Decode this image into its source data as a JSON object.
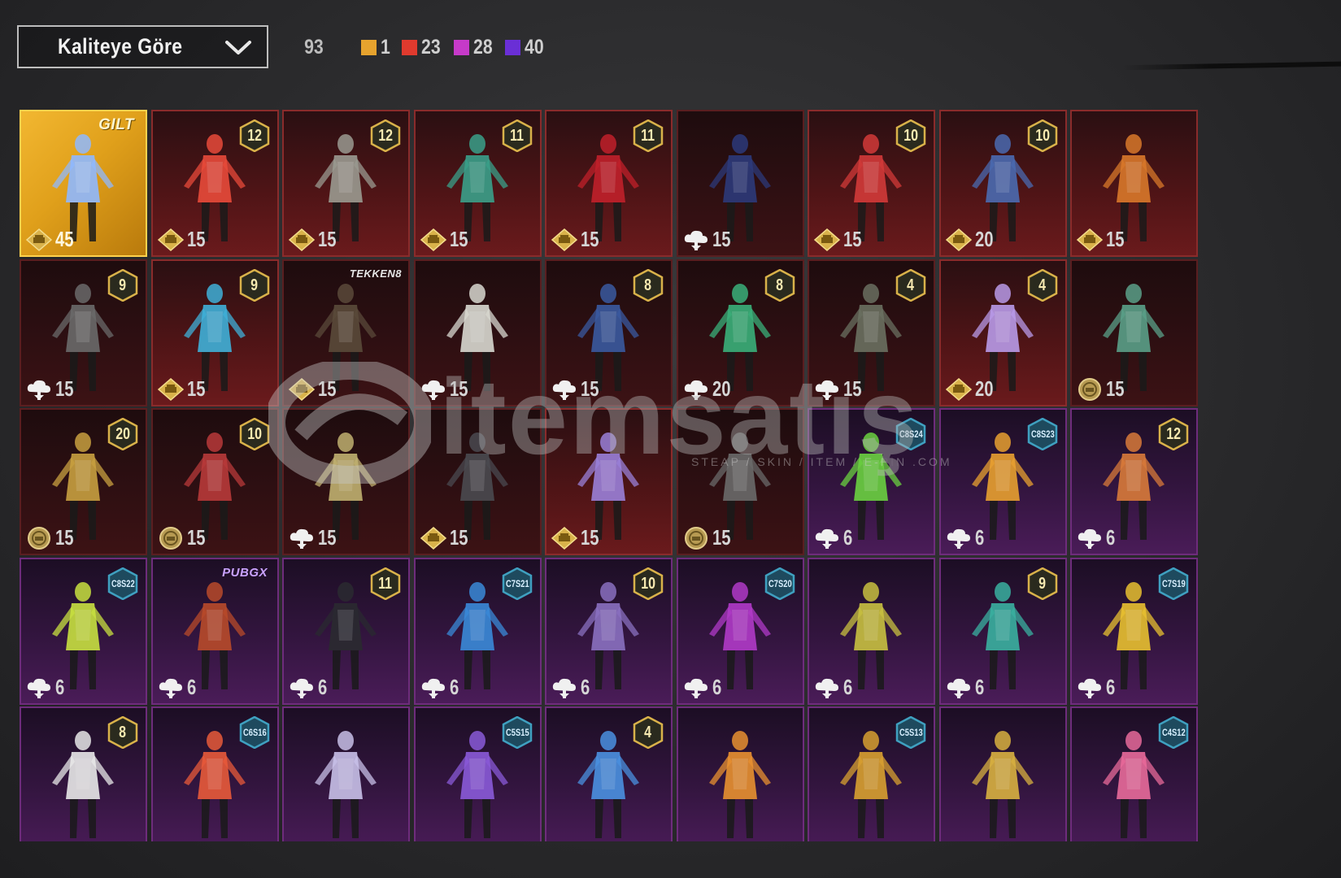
{
  "sort": {
    "label": "Kaliteye Göre"
  },
  "counts": {
    "total": "93",
    "tiers": [
      {
        "color": "#e6a32e",
        "value": "1"
      },
      {
        "color": "#e03a2e",
        "value": "23"
      },
      {
        "color": "#c63ac9",
        "value": "28"
      },
      {
        "color": "#6a2fd6",
        "value": "40"
      }
    ]
  },
  "watermark": {
    "text": "itemsatış",
    "sub": "STEAP / SKIN / ITEM / E-PIN .COM"
  },
  "items": [
    {
      "style": "gold",
      "brand": "GILT",
      "cost": "45",
      "currency": "gold",
      "figure": "#8fb8ff"
    },
    {
      "style": "red",
      "badge": "12",
      "cost": "15",
      "currency": "gold",
      "figure": "#e84a3a"
    },
    {
      "style": "red",
      "badge": "12",
      "cost": "15",
      "currency": "gold",
      "figure": "#9a9a90"
    },
    {
      "style": "red",
      "badge": "11",
      "cost": "15",
      "currency": "gold",
      "figure": "#3aa08a"
    },
    {
      "style": "red",
      "badge": "11",
      "cost": "15",
      "currency": "gold",
      "figure": "#c0202a"
    },
    {
      "style": "red-dark",
      "cost": "15",
      "currency": "cloud",
      "figure": "#2c3a7a"
    },
    {
      "style": "red",
      "badge": "10",
      "cost": "15",
      "currency": "gold",
      "figure": "#d23a38"
    },
    {
      "style": "red",
      "badge": "10",
      "cost": "20",
      "currency": "gold",
      "figure": "#4a6ab0"
    },
    {
      "style": "red",
      "cost": "15",
      "currency": "gold",
      "figure": "#d8782a"
    },
    {
      "style": "red-dark",
      "badge": "9",
      "cost": "15",
      "currency": "cloud",
      "figure": "#6a6a6a"
    },
    {
      "style": "red",
      "badge": "9",
      "cost": "15",
      "currency": "gold",
      "figure": "#3fb0d8"
    },
    {
      "style": "red-dark",
      "brand": "TEKKEN8",
      "cost": "15",
      "currency": "gold",
      "figure": "#5a4a3a"
    },
    {
      "style": "red-dark",
      "cost": "15",
      "currency": "cloud",
      "figure": "#d8d8d0"
    },
    {
      "style": "red-dark",
      "badge": "8",
      "cost": "15",
      "currency": "cloud",
      "figure": "#3a5aa0"
    },
    {
      "style": "red-dark",
      "badge": "8",
      "cost": "20",
      "currency": "cloud",
      "figure": "#3ab07a"
    },
    {
      "style": "red-dark",
      "badge": "4",
      "cost": "15",
      "currency": "cloud",
      "figure": "#6a7060"
    },
    {
      "style": "red",
      "badge": "4",
      "cost": "20",
      "currency": "gold",
      "figure": "#b89ae8"
    },
    {
      "style": "red-dark",
      "cost": "15",
      "currency": "coin",
      "figure": "#5aa088"
    },
    {
      "style": "red-dark",
      "badge": "20",
      "cost": "15",
      "currency": "coin",
      "figure": "#c8a040"
    },
    {
      "style": "red-dark",
      "badge": "10",
      "cost": "15",
      "currency": "coin",
      "figure": "#b83a3a"
    },
    {
      "style": "red-dark",
      "cost": "15",
      "currency": "cloud",
      "figure": "#c0b070"
    },
    {
      "style": "red-dark",
      "cost": "15",
      "currency": "gold",
      "figure": "#4a4a50"
    },
    {
      "style": "red",
      "cost": "15",
      "currency": "gold",
      "figure": "#9a80d8"
    },
    {
      "style": "red-dark",
      "cost": "15",
      "currency": "coin",
      "figure": "#6a6a6a"
    },
    {
      "style": "purple",
      "badge": "C8S24",
      "season": true,
      "cost": "6",
      "currency": "cloud",
      "figure": "#6ad040"
    },
    {
      "style": "purple",
      "badge": "C8S23",
      "season": true,
      "cost": "6",
      "currency": "cloud",
      "figure": "#e8a030"
    },
    {
      "style": "purple",
      "badge": "12",
      "cost": "6",
      "currency": "cloud",
      "figure": "#d87a3a"
    },
    {
      "style": "purple",
      "badge": "C8S22",
      "season": true,
      "cost": "6",
      "currency": "cloud",
      "figure": "#c8e040"
    },
    {
      "style": "purple",
      "brand": "PUBGX",
      "cost": "6",
      "currency": "cloud",
      "figure": "#b84a2a"
    },
    {
      "style": "purple",
      "badge": "11",
      "cost": "6",
      "currency": "cloud",
      "figure": "#2a2a30"
    },
    {
      "style": "purple",
      "badge": "C7S21",
      "season": true,
      "cost": "6",
      "currency": "cloud",
      "figure": "#3a8ad8"
    },
    {
      "style": "purple",
      "badge": "10",
      "cost": "6",
      "currency": "cloud",
      "figure": "#8a70c0"
    },
    {
      "style": "purple",
      "badge": "C7S20",
      "season": true,
      "cost": "6",
      "currency": "cloud",
      "figure": "#b03ac8"
    },
    {
      "style": "purple",
      "cost": "6",
      "currency": "cloud",
      "figure": "#c8c040"
    },
    {
      "style": "purple",
      "badge": "9",
      "cost": "6",
      "currency": "cloud",
      "figure": "#3ab0a0"
    },
    {
      "style": "purple",
      "badge": "C7S19",
      "season": true,
      "cost": "6",
      "currency": "cloud",
      "figure": "#e8c030"
    },
    {
      "style": "purple",
      "badge": "8",
      "cost": "",
      "currency": "none",
      "figure": "#e8e8e8"
    },
    {
      "style": "purple",
      "badge": "C6S16",
      "season": true,
      "cost": "",
      "currency": "none",
      "figure": "#e85a3a"
    },
    {
      "style": "purple",
      "cost": "",
      "currency": "none",
      "figure": "#c8c0e8"
    },
    {
      "style": "purple",
      "badge": "C5S15",
      "season": true,
      "cost": "",
      "currency": "none",
      "figure": "#8a5ad8"
    },
    {
      "style": "purple",
      "badge": "4",
      "cost": "",
      "currency": "none",
      "figure": "#4a90e0"
    },
    {
      "style": "purple",
      "cost": "",
      "currency": "none",
      "figure": "#e89030"
    },
    {
      "style": "purple",
      "badge": "C5S13",
      "season": true,
      "cost": "",
      "currency": "none",
      "figure": "#d8a030"
    },
    {
      "style": "purple",
      "cost": "",
      "currency": "none",
      "figure": "#d8b040"
    },
    {
      "style": "purple",
      "badge": "C4S12",
      "season": true,
      "cost": "",
      "currency": "none",
      "figure": "#e86a9a"
    }
  ]
}
